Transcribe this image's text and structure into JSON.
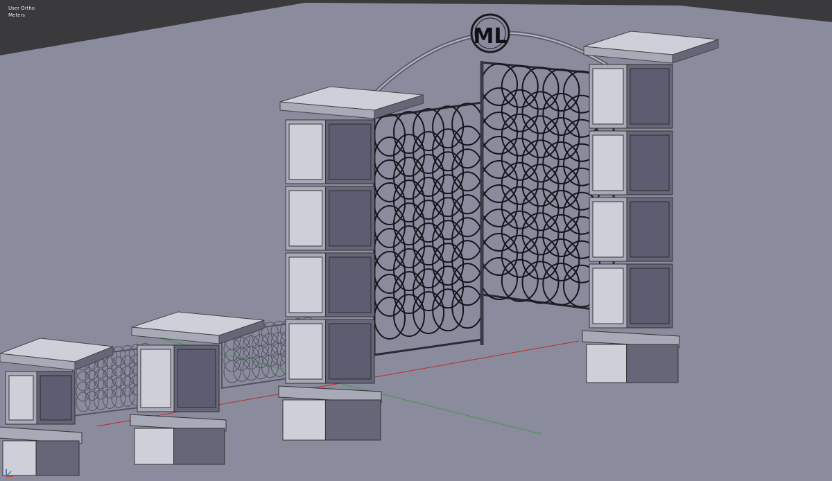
{
  "viewport": {
    "view_name": "User Ortho",
    "units": "Meters",
    "monogram": "ML"
  },
  "colors": {
    "background": "#8a8a9c",
    "ground": "#8a8b9d",
    "pillar_light": "#cfcfd9",
    "pillar_mid": "#a9aab8",
    "pillar_dark": "#656678",
    "gate_wire": "#15151c",
    "axis_x": "#c02b2b",
    "axis_y": "#3f9d3f"
  },
  "icons": [
    "axis-gizmo-icon"
  ]
}
